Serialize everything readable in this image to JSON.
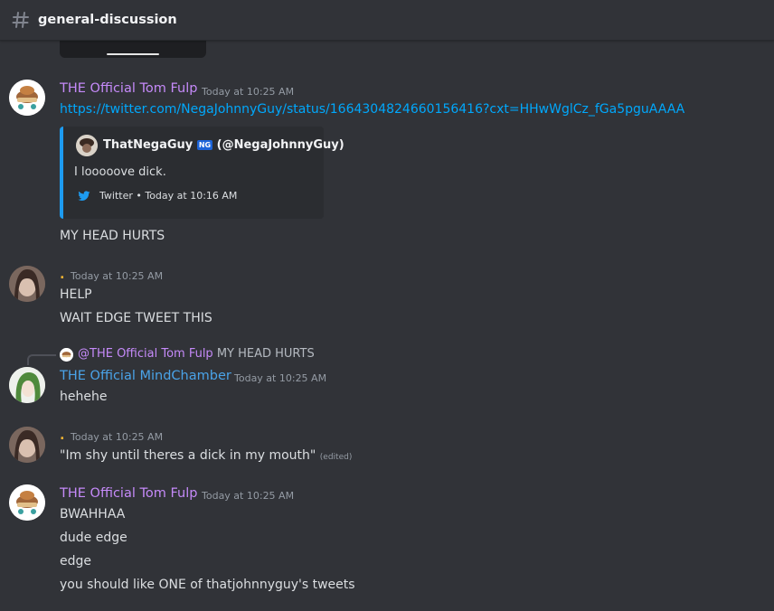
{
  "channel": {
    "name": "general-discussion"
  },
  "messages": [
    {
      "author": "THE Official Tom Fulp",
      "timestamp": "Today at 10:25 AM",
      "link": "https://twitter.com/NegaJohnnyGuy/status/1664304824660156416?cxt=HHwWglCz_fGa5pguAAAA",
      "embed": {
        "author": "ThatNegaGuy",
        "badge": "NG",
        "handle": "(@NegaJohnnyGuy)",
        "description": "I looooove dick.",
        "footer": "Twitter • Today at 10:16 AM"
      },
      "lines": [
        "MY HEAD HURTS"
      ]
    },
    {
      "author": ".",
      "timestamp": "Today at 10:25 AM",
      "lines": [
        "HELP",
        "WAIT EDGE TWEET THIS"
      ]
    },
    {
      "reply": {
        "mention": "@THE Official Tom Fulp",
        "content": "MY HEAD HURTS"
      },
      "author": "THE Official MindChamber",
      "timestamp": "Today at 10:25 AM",
      "lines": [
        "hehehe"
      ]
    },
    {
      "author": ".",
      "timestamp": "Today at 10:25 AM",
      "lines": [
        "\"Im shy until theres a dick in my mouth\""
      ],
      "edited": "(edited)"
    },
    {
      "author": "THE Official Tom Fulp",
      "timestamp": "Today at 10:25 AM",
      "lines": [
        "BWAHHAA",
        "dude edge",
        "edge",
        "you should like ONE of thatjohnnyguy's tweets"
      ]
    }
  ],
  "icons": {
    "channel": "hash-icon",
    "embed_footer": "twitter-bird-icon"
  },
  "colors": {
    "background": "#313338",
    "link": "#00a8fc",
    "tom_name": "#c58af9",
    "mind_name": "#4aa3e8",
    "dot_name": "#f0b232",
    "embed_border": "#1d9bf0"
  }
}
